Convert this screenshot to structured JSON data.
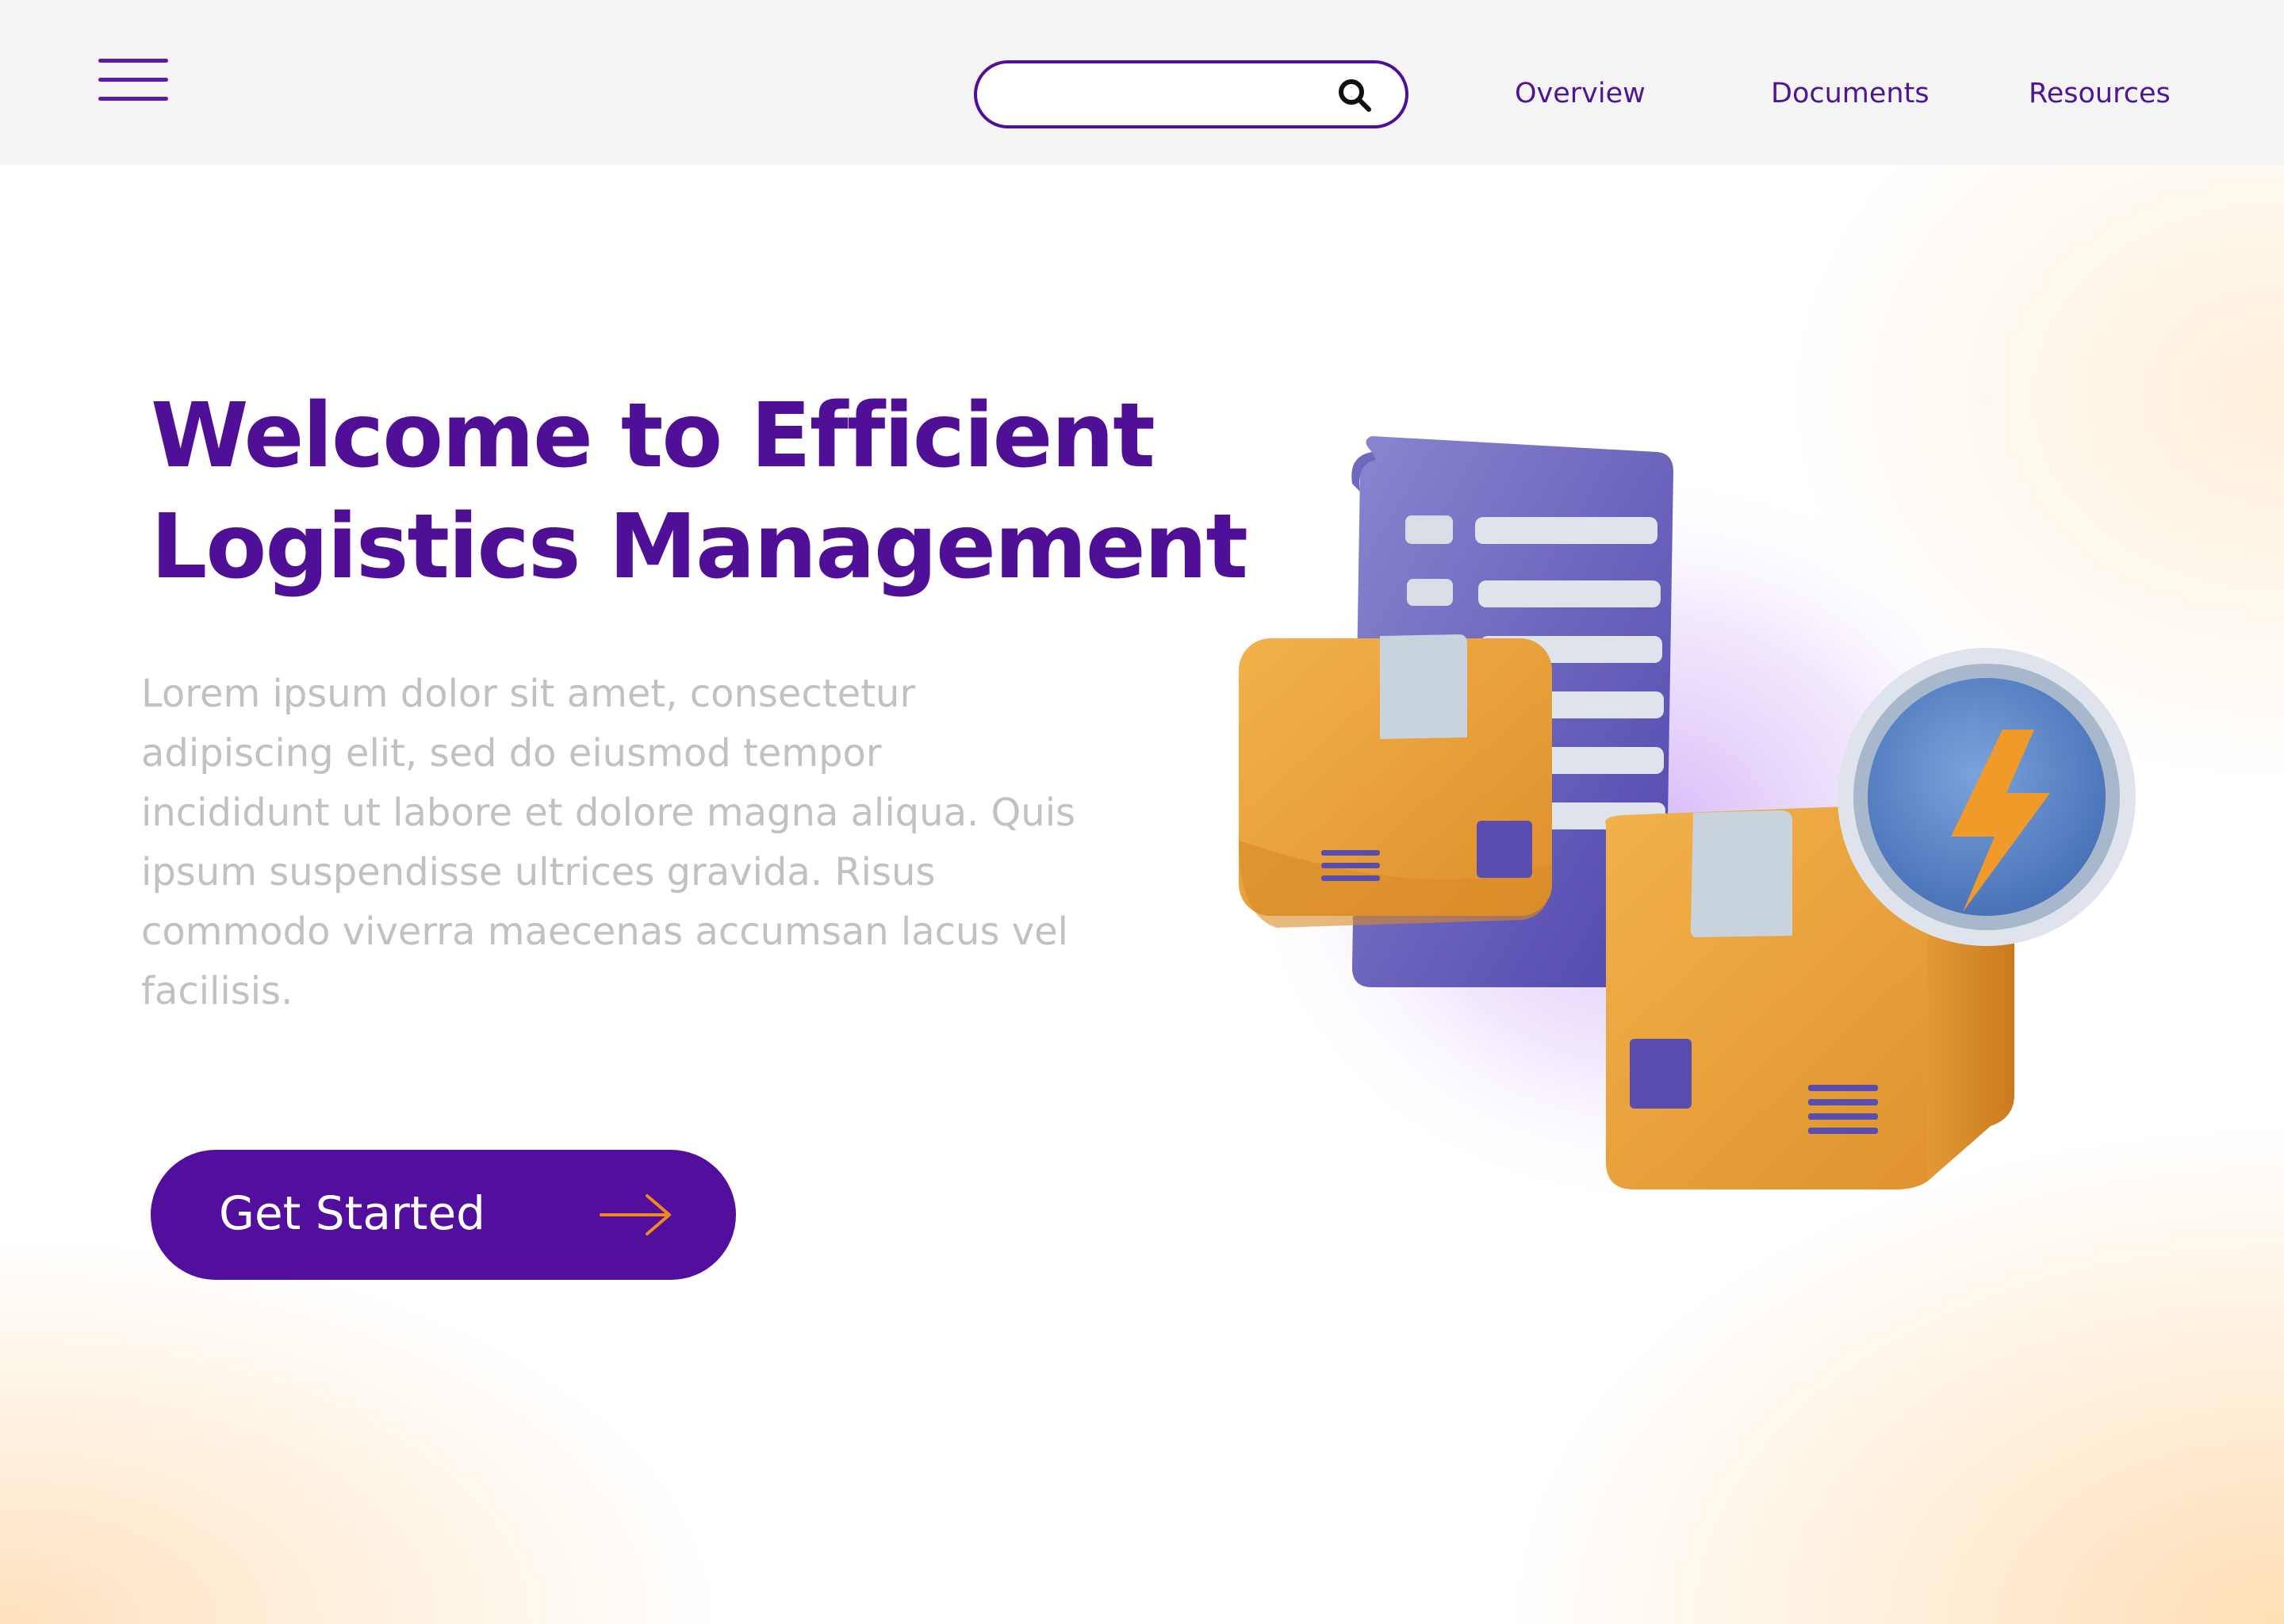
{
  "header": {
    "search": {
      "value": "",
      "placeholder": ""
    },
    "nav": [
      {
        "label": "Overview"
      },
      {
        "label": "Documents"
      },
      {
        "label": "Resources"
      }
    ]
  },
  "hero": {
    "title_line1": "Welcome to Efficient",
    "title_line2": "Logistics Management",
    "paragraph_lines": [
      "Lorem ipsum dolor sit amet, consectetur",
      "adipiscing elit, sed do eiusmod tempor",
      "incididunt ut labore et dolore magna aliqua. Quis",
      "ipsum suspendisse ultrices gravida. Risus",
      "commodo viverra maecenas accumsan lacus vel",
      "facilisis."
    ],
    "cta_label": "Get Started"
  },
  "icons": {
    "menu": "hamburger-menu-icon",
    "search": "search-icon",
    "cta_arrow": "arrow-right-icon",
    "illustration": [
      "document-icon",
      "package-box-icon",
      "lightning-coin-icon"
    ]
  },
  "colors": {
    "brand_purple": "#520e9c",
    "nav_text": "#4e1692",
    "body_text": "#c1c1c1",
    "header_bg": "#f4f4f4",
    "box_orange": "#e8a33a",
    "accent_orange": "#f08a1c",
    "coin_blue": "#5b86c8"
  }
}
